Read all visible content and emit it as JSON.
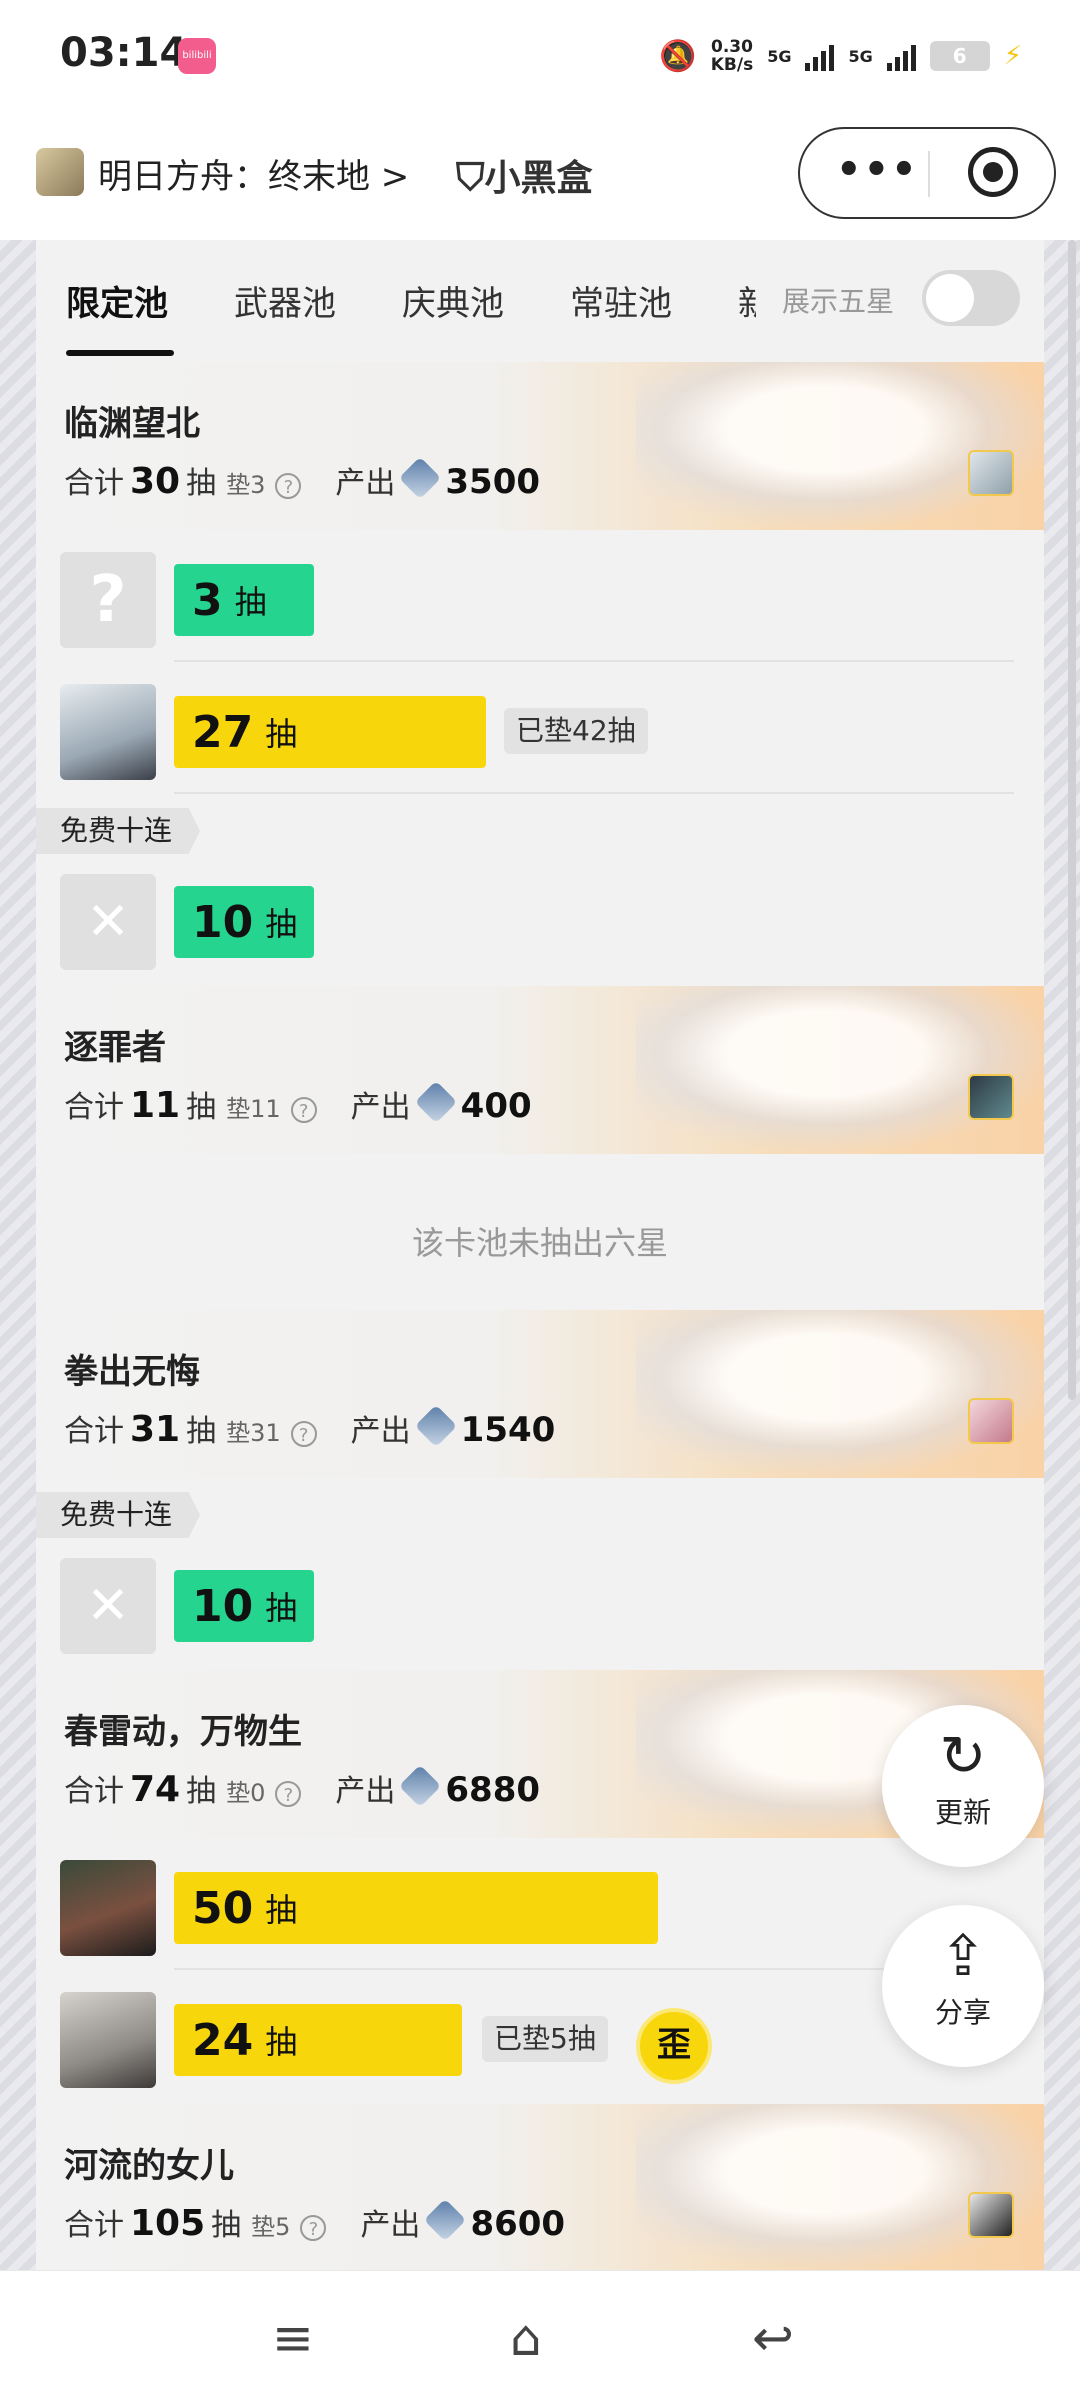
{
  "status": {
    "time": "03:14",
    "app_badge": "bilibili",
    "net_speed_value": "0.30",
    "net_speed_unit": "KB/s",
    "sig1": "5G",
    "sig2": "5G",
    "battery": "6"
  },
  "appbar": {
    "game": "明日方舟：终末地 >",
    "brand": "小黑盒",
    "more": "•••"
  },
  "tabs": [
    {
      "label": "限定池"
    },
    {
      "label": "武器池"
    },
    {
      "label": "庆典池"
    },
    {
      "label": "常驻池"
    },
    {
      "label": "新"
    }
  ],
  "five_star_label": "展示五星",
  "show_five_star": false,
  "labels": {
    "total": "合计",
    "draw": "抽",
    "output": "产出",
    "free_ten": "免费十连",
    "no_six": "该卡池未抽出六星",
    "wai": "歪"
  },
  "pools": [
    {
      "name": "临渊望北",
      "total": "30",
      "pad": "垫3",
      "output": "3500",
      "rows": [
        {
          "count": "3",
          "draw": "抽",
          "color": "green",
          "avatar": "?"
        },
        {
          "count": "27",
          "draw": "抽",
          "color": "yellow",
          "pad_tag": "已垫42抽"
        }
      ],
      "free": {
        "count": "10",
        "draw": "抽",
        "avatar": "✕"
      }
    },
    {
      "name": "逐罪者",
      "total": "11",
      "pad": "垫11",
      "output": "400"
    },
    {
      "name": "拳出无悔",
      "total": "31",
      "pad": "垫31",
      "output": "1540",
      "free": {
        "count": "10",
        "draw": "抽",
        "avatar": "✕"
      }
    },
    {
      "name": "春雷动，万物生",
      "total": "74",
      "pad": "垫0",
      "output": "6880",
      "rows": [
        {
          "count": "50",
          "draw": "抽",
          "color": "yellow"
        },
        {
          "count": "24",
          "draw": "抽",
          "color": "yellow",
          "pad_tag": "已垫5抽",
          "wai": true
        }
      ]
    },
    {
      "name": "河流的女儿",
      "total": "105",
      "pad": "垫5",
      "output": "8600"
    }
  ],
  "fab": {
    "refresh": "更新",
    "share": "分享"
  },
  "nav": {
    "menu": "≡",
    "home": "⌂",
    "back": "↩"
  },
  "colors": {
    "green_bar": "#25d58f",
    "yellow_bar": "#f7d70c",
    "pool_banner": "#f9d2a7"
  }
}
